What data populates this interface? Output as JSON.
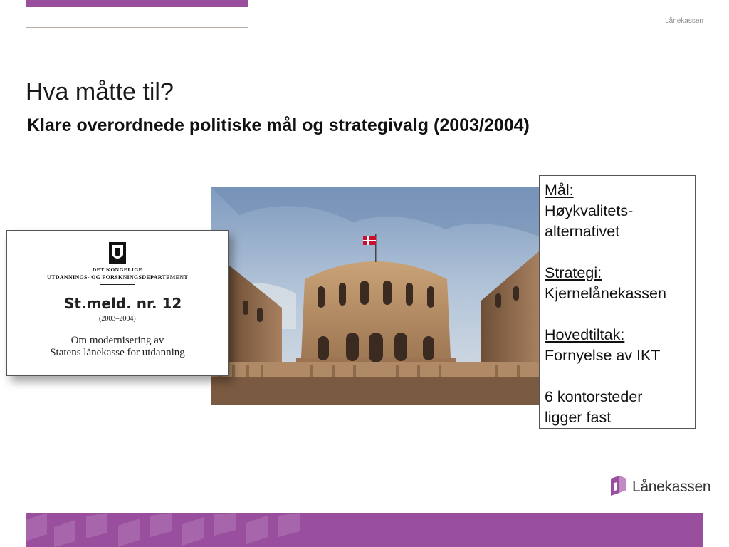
{
  "header": {
    "brand": "Lånekassen"
  },
  "slide": {
    "title": "Hva måtte til?",
    "subtitle": "Klare overordnede politiske mål og strategivalg  (2003/2004)"
  },
  "document": {
    "dept_line1": "DET KONGELIGE",
    "dept_line2": "UTDANNINGS- OG FORSKNINGSDEPARTEMENT",
    "reference": "St.meld. nr. 12",
    "years": "(2003–2004)",
    "title_line1": "Om modernisering av",
    "title_line2": "Statens lånekasse for utdanning"
  },
  "info_box": {
    "goal_heading": "Mål:",
    "goal_line1": "Høykvalitets-",
    "goal_line2": "alternativet",
    "strategy_heading": "Strategi:",
    "strategy_text": "Kjernelånekassen",
    "measure_heading": "Hovedtiltak:",
    "measure_text": "Fornyelse av IKT",
    "offices_line1": "6 kontorsteder",
    "offices_line2": "ligger fast"
  },
  "footer": {
    "logo_text": "Lånekassen"
  },
  "colors": {
    "brand_purple": "#9a4f9e",
    "rule": "#b9b0a2"
  }
}
